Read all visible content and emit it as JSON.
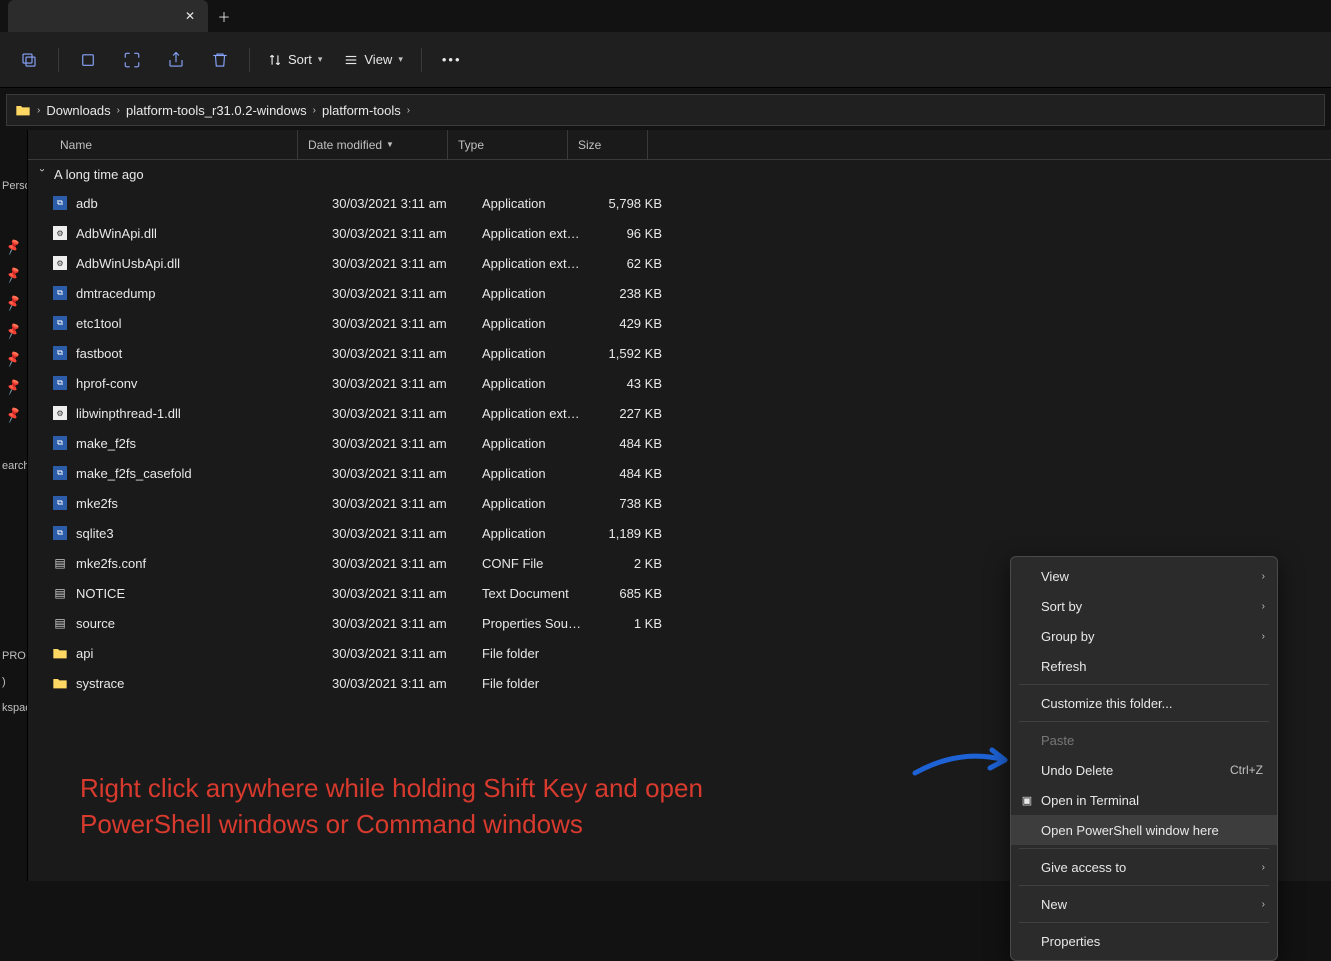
{
  "tab": {
    "title": ""
  },
  "toolbar": {
    "sort": "Sort",
    "view": "View"
  },
  "breadcrumb": {
    "segments": [
      "Downloads",
      "platform-tools_r31.0.2-windows",
      "platform-tools"
    ]
  },
  "leftstrip": {
    "label_personal": "Perso",
    "label_search": "earch",
    "label_pro": "PRO",
    "label_paren": ")",
    "label_kspac": "kspac"
  },
  "columns": {
    "name": "Name",
    "date": "Date modified",
    "type": "Type",
    "size": "Size"
  },
  "group": {
    "label": "A long time ago"
  },
  "files": [
    {
      "icon": "exe",
      "name": "adb",
      "date": "30/03/2021 3:11 am",
      "type": "Application",
      "size": "5,798 KB"
    },
    {
      "icon": "dll",
      "name": "AdbWinApi.dll",
      "date": "30/03/2021 3:11 am",
      "type": "Application exten...",
      "size": "96 KB"
    },
    {
      "icon": "dll",
      "name": "AdbWinUsbApi.dll",
      "date": "30/03/2021 3:11 am",
      "type": "Application exten...",
      "size": "62 KB"
    },
    {
      "icon": "exe",
      "name": "dmtracedump",
      "date": "30/03/2021 3:11 am",
      "type": "Application",
      "size": "238 KB"
    },
    {
      "icon": "exe",
      "name": "etc1tool",
      "date": "30/03/2021 3:11 am",
      "type": "Application",
      "size": "429 KB"
    },
    {
      "icon": "exe",
      "name": "fastboot",
      "date": "30/03/2021 3:11 am",
      "type": "Application",
      "size": "1,592 KB"
    },
    {
      "icon": "exe",
      "name": "hprof-conv",
      "date": "30/03/2021 3:11 am",
      "type": "Application",
      "size": "43 KB"
    },
    {
      "icon": "dll",
      "name": "libwinpthread-1.dll",
      "date": "30/03/2021 3:11 am",
      "type": "Application exten...",
      "size": "227 KB"
    },
    {
      "icon": "exe",
      "name": "make_f2fs",
      "date": "30/03/2021 3:11 am",
      "type": "Application",
      "size": "484 KB"
    },
    {
      "icon": "exe",
      "name": "make_f2fs_casefold",
      "date": "30/03/2021 3:11 am",
      "type": "Application",
      "size": "484 KB"
    },
    {
      "icon": "exe",
      "name": "mke2fs",
      "date": "30/03/2021 3:11 am",
      "type": "Application",
      "size": "738 KB"
    },
    {
      "icon": "exe",
      "name": "sqlite3",
      "date": "30/03/2021 3:11 am",
      "type": "Application",
      "size": "1,189 KB"
    },
    {
      "icon": "txt",
      "name": "mke2fs.conf",
      "date": "30/03/2021 3:11 am",
      "type": "CONF File",
      "size": "2 KB"
    },
    {
      "icon": "txt",
      "name": "NOTICE",
      "date": "30/03/2021 3:11 am",
      "type": "Text Document",
      "size": "685 KB"
    },
    {
      "icon": "txt",
      "name": "source",
      "date": "30/03/2021 3:11 am",
      "type": "Properties Source ...",
      "size": "1 KB"
    },
    {
      "icon": "folder",
      "name": "api",
      "date": "30/03/2021 3:11 am",
      "type": "File folder",
      "size": ""
    },
    {
      "icon": "folder",
      "name": "systrace",
      "date": "30/03/2021 3:11 am",
      "type": "File folder",
      "size": ""
    }
  ],
  "annotation": {
    "line1": "Right click anywhere while holding Shift Key and open",
    "line2": "PowerShell windows or Command windows"
  },
  "ctx": {
    "view": "View",
    "sort_by": "Sort by",
    "group_by": "Group by",
    "refresh": "Refresh",
    "customize": "Customize this folder...",
    "paste": "Paste",
    "undo_delete": "Undo Delete",
    "undo_short": "Ctrl+Z",
    "open_terminal": "Open in Terminal",
    "open_ps": "Open PowerShell window here",
    "give_access": "Give access to",
    "new": "New",
    "properties": "Properties"
  }
}
